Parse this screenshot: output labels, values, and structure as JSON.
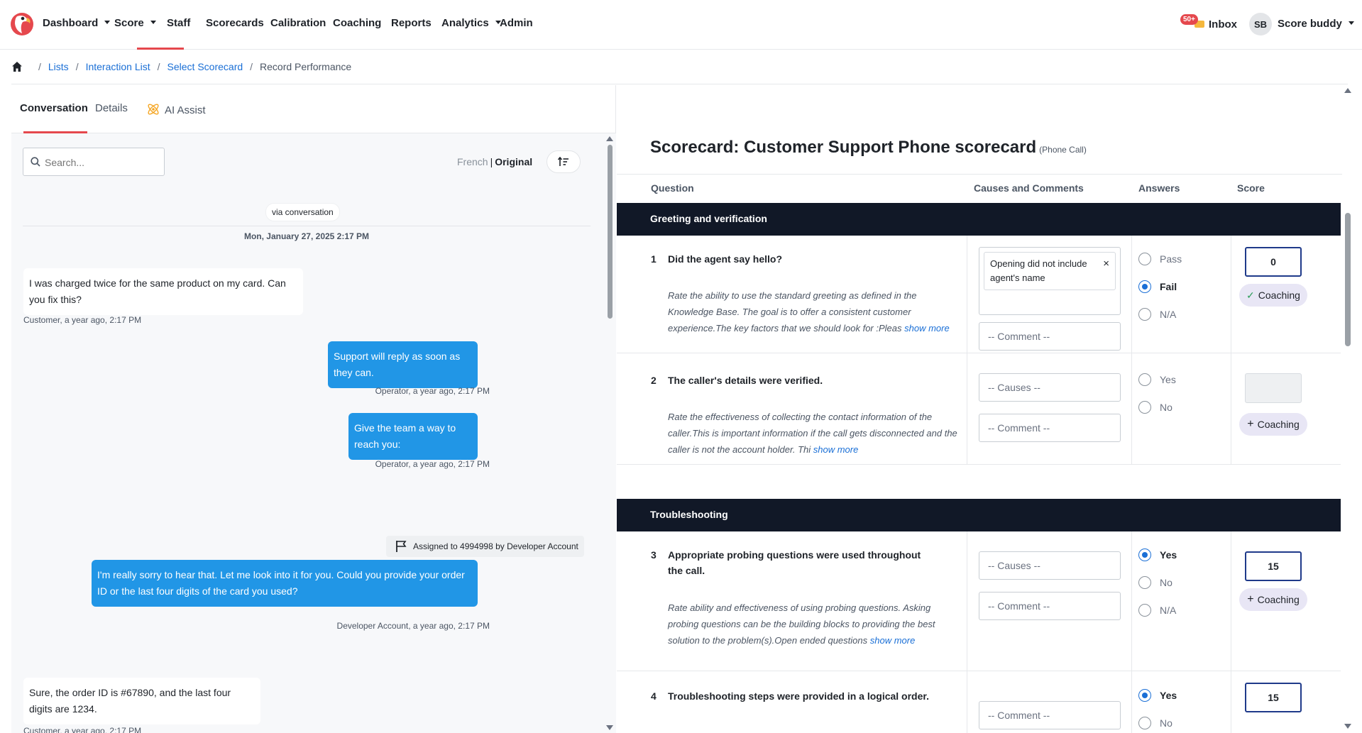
{
  "nav": {
    "items": [
      {
        "label": "Dashboard",
        "dropdown": true
      },
      {
        "label": "Score",
        "dropdown": true,
        "active": true
      },
      {
        "label": "Staff",
        "dropdown": false
      },
      {
        "label": "Scorecards",
        "dropdown": false
      },
      {
        "label": "Calibration",
        "dropdown": false
      },
      {
        "label": "Coaching",
        "dropdown": false
      },
      {
        "label": "Reports",
        "dropdown": false
      },
      {
        "label": "Analytics",
        "dropdown": true
      },
      {
        "label": "Admin",
        "dropdown": false
      }
    ],
    "inbox_badge": "50+",
    "inbox_label": "Inbox",
    "avatar_initials": "SB",
    "user_name": "Score buddy",
    "accent_color": "#e5484d"
  },
  "breadcrumb": {
    "items": [
      "Lists",
      "Interaction List",
      "Select Scorecard"
    ],
    "current": "Record Performance"
  },
  "left": {
    "tabs": [
      "Conversation",
      "Details",
      "AI Assist"
    ],
    "active_tab": "Conversation",
    "search_placeholder": "Search...",
    "lang_translated": "French",
    "lang_separator": "|",
    "lang_original": "Original",
    "via_label": "via conversation",
    "date_label": "Mon, January 27, 2025 2:17 PM",
    "messages": [
      {
        "role": "customer",
        "text": "I was charged twice for the same product on my card. Can you fix this?",
        "meta": "Customer, a year ago, 2:17 PM"
      },
      {
        "role": "operator",
        "text": "Support will reply as soon as they can.",
        "meta": "Operator, a year ago, 2:17 PM"
      },
      {
        "role": "operator",
        "text": "Give the team a way to reach you:",
        "meta": "Operator, a year ago, 2:17 PM"
      },
      {
        "role": "operator",
        "text": "I'm really sorry to hear that. Let me look into it for you. Could you provide your order ID or the last four digits of the card you used?",
        "meta": "Developer Account, a year ago, 2:17 PM"
      },
      {
        "role": "customer",
        "text": "Sure, the order ID is #67890, and the last four digits are 1234.",
        "meta": "Customer, a year ago, 2:17 PM"
      }
    ],
    "assignment": "Assigned to 4994998 by Developer Account",
    "operator_bubble_color": "#2196e6"
  },
  "scorecard": {
    "title": "Scorecard: Customer Support Phone scorecard",
    "subtitle": "(Phone Call)",
    "columns": [
      "Question",
      "Causes and Comments",
      "Answers",
      "Score"
    ],
    "sections": [
      {
        "name": "Greeting and verification",
        "questions": [
          {
            "num": "1",
            "text": "Did the agent say hello?",
            "desc": "Rate the ability to use the standard greeting as defined in the Knowledge Base. The goal is to offer a consistent customer experience.The key factors that we should look for :Pleas",
            "show_more": "show more",
            "cause_chip": "Opening did not include agent's name",
            "comment_placeholder": "-- Comment --",
            "answers": [
              "Pass",
              "Fail",
              "N/A"
            ],
            "selected": "Fail",
            "score": "0",
            "coaching": "Coaching",
            "coaching_state": "checked"
          },
          {
            "num": "2",
            "text": "The caller's details were verified.",
            "desc": "Rate the effectiveness of collecting the contact information of the caller.This is important information if the call gets disconnected and the caller is not the account holder. Thi",
            "show_more": "show more",
            "causes_placeholder": "-- Causes --",
            "comment_placeholder": "-- Comment --",
            "answers": [
              "Yes",
              "No"
            ],
            "selected": "",
            "score": "",
            "coaching": "Coaching",
            "coaching_state": "add"
          }
        ]
      },
      {
        "name": "Troubleshooting",
        "questions": [
          {
            "num": "3",
            "text": "Appropriate probing questions were used throughout the call.",
            "desc": "Rate ability and effectiveness of using probing questions. Asking probing questions can be the building blocks to providing the best solution to the problem(s).Open ended questions",
            "show_more": "show more",
            "causes_placeholder": "-- Causes --",
            "comment_placeholder": "-- Comment --",
            "answers": [
              "Yes",
              "No",
              "N/A"
            ],
            "selected": "Yes",
            "score": "15",
            "coaching": "Coaching",
            "coaching_state": "add"
          },
          {
            "num": "4",
            "text": "Troubleshooting steps were provided in a logical order.",
            "comment_placeholder": "-- Comment --",
            "answers": [
              "Yes",
              "No"
            ],
            "selected": "Yes",
            "score": "15"
          }
        ]
      }
    ]
  }
}
